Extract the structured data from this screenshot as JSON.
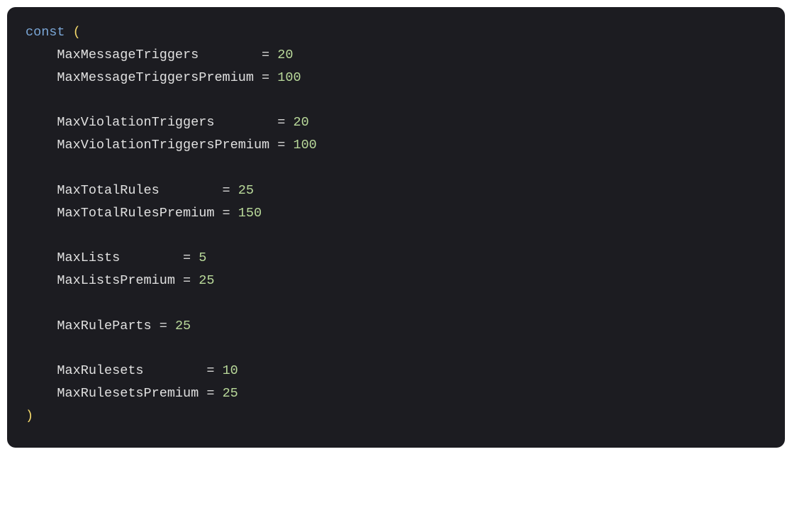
{
  "keyword": "const",
  "paren_open": "(",
  "paren_close": ")",
  "eq": "=",
  "groups": [
    {
      "ident_width": 25,
      "decls": [
        {
          "name": "MaxMessageTriggers",
          "value": "20"
        },
        {
          "name": "MaxMessageTriggersPremium",
          "value": "100"
        }
      ]
    },
    {
      "ident_width": 27,
      "decls": [
        {
          "name": "MaxViolationTriggers",
          "value": "20"
        },
        {
          "name": "MaxViolationTriggersPremium",
          "value": "100"
        }
      ]
    },
    {
      "ident_width": 20,
      "decls": [
        {
          "name": "MaxTotalRules",
          "value": "25"
        },
        {
          "name": "MaxTotalRulesPremium",
          "value": "150"
        }
      ]
    },
    {
      "ident_width": 15,
      "decls": [
        {
          "name": "MaxLists",
          "value": "5"
        },
        {
          "name": "MaxListsPremium",
          "value": "25"
        }
      ]
    },
    {
      "ident_width": 12,
      "decls": [
        {
          "name": "MaxRuleParts",
          "value": "25"
        }
      ]
    },
    {
      "ident_width": 18,
      "decls": [
        {
          "name": "MaxRulesets",
          "value": "10"
        },
        {
          "name": "MaxRulesetsPremium",
          "value": "25"
        }
      ]
    }
  ]
}
